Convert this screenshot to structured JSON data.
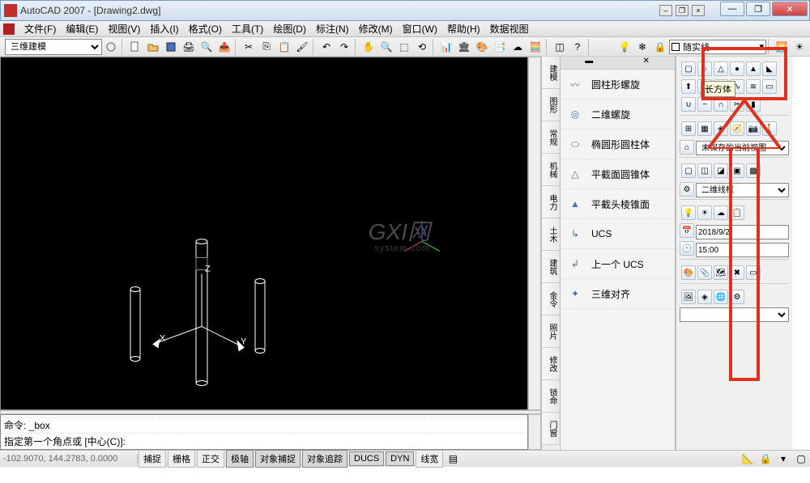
{
  "title": "AutoCAD 2007 - [Drawing2.dwg]",
  "menus": [
    "文件(F)",
    "编辑(E)",
    "视图(V)",
    "插入(I)",
    "格式(O)",
    "工具(T)",
    "绘图(D)",
    "标注(N)",
    "修改(M)",
    "窗口(W)",
    "帮助(H)",
    "数据视图"
  ],
  "workspace": "三维建模",
  "layer_combo": "随实线",
  "palette_tabs": [
    "建模",
    "图形",
    "常规",
    "机械",
    "电力",
    "土木",
    "建筑",
    "金令",
    "照片",
    "修改",
    "锁命",
    "门窗"
  ],
  "palette_items": [
    {
      "label": "圆柱形螺旋"
    },
    {
      "label": "二维螺旋"
    },
    {
      "label": "椭圆形圆柱体"
    },
    {
      "label": "平截面圆锥体"
    },
    {
      "label": "平截头棱锥面"
    },
    {
      "label": "UCS"
    },
    {
      "label": "上一个 UCS"
    },
    {
      "label": "三维对齐"
    }
  ],
  "tooltip": "长方体",
  "right_combos": {
    "view": "未保存的当前视图",
    "visual": "二维线框",
    "date": "2018/9/2",
    "time": "15:00"
  },
  "cmd": {
    "line1": "",
    "line2": "命令: _box",
    "prompt": "指定第一个角点或 [中心(C)]:"
  },
  "status": {
    "coords": "-102.9070, 144.2783, 0.0000",
    "toggles": [
      "捕捉",
      "栅格",
      "正交",
      "极轴",
      "对象捕捉",
      "对象追踪",
      "DUCS",
      "DYN",
      "线宽"
    ]
  },
  "watermark": {
    "big": "GXI网",
    "small": "system.com"
  },
  "axis": {
    "x": "X",
    "y": "Y",
    "z": "Z"
  }
}
